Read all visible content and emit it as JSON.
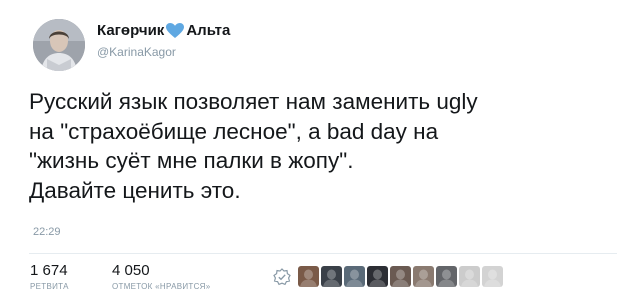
{
  "author": {
    "display_name_part1": "Кагөрчик",
    "display_name_part2": "Альта",
    "heart_color": "#5fa8e2",
    "handle": "@KarinaKagor"
  },
  "tweet": {
    "lines": [
      "Русский язык позволяет нам заменить ugly",
      "на \"страхоёбище лесное\", а bad day на",
      "\"жизнь суёт мне палки в жопу\".",
      "Давайте ценить это."
    ],
    "time": "22:29"
  },
  "stats": {
    "retweets": {
      "value": "1 674",
      "label": "РЕТВИТА"
    },
    "likes": {
      "value": "4 050",
      "label": "ОТМЕТОК «НРАВИТСЯ»"
    }
  },
  "likers": [
    {
      "color": "#7a5a48"
    },
    {
      "color": "#3a4048"
    },
    {
      "color": "#5a6a78"
    },
    {
      "color": "#2c2e34"
    },
    {
      "color": "#6a5a52"
    },
    {
      "color": "#8a7a70"
    },
    {
      "color": "#303238"
    },
    {
      "color": "#9a9a9a"
    },
    {
      "color": "#555555"
    }
  ]
}
